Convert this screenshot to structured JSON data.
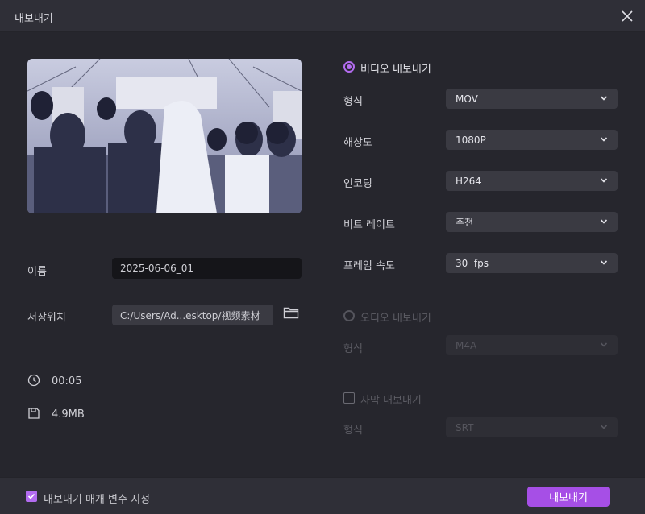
{
  "dialog": {
    "title": "내보내기"
  },
  "left": {
    "name_label": "이름",
    "name_value": "2025-06-06_01",
    "location_label": "저장위치",
    "location_value": "C:/Users/Ad...esktop/视频素材",
    "duration": "00:05",
    "size": "4.9MB"
  },
  "video_export": {
    "label": "비디오 내보내기",
    "selected": true,
    "fields": [
      {
        "label": "형식",
        "value": "MOV"
      },
      {
        "label": "해상도",
        "value": "1080P"
      },
      {
        "label": "인코딩",
        "value": "H264"
      },
      {
        "label": "비트 레이트",
        "value": "추천"
      },
      {
        "label": "프레임 속도",
        "value": "30  fps"
      }
    ]
  },
  "audio_export": {
    "label": "오디오 내보내기",
    "selected": false,
    "format_label": "형식",
    "format_value": "M4A"
  },
  "subtitle_export": {
    "label": "자막 내보내기",
    "checked": false,
    "format_label": "형식",
    "format_value": "SRT"
  },
  "footer": {
    "remember_label": "내보내기 매개 변수 지정",
    "remember_checked": true,
    "export_button": "내보내기"
  },
  "colors": {
    "accent": "#a64fe6",
    "radio": "#b36cf0"
  },
  "icons": [
    "close-icon",
    "folder-icon",
    "clock-icon",
    "save-icon",
    "chevron-down-icon",
    "check-icon"
  ]
}
